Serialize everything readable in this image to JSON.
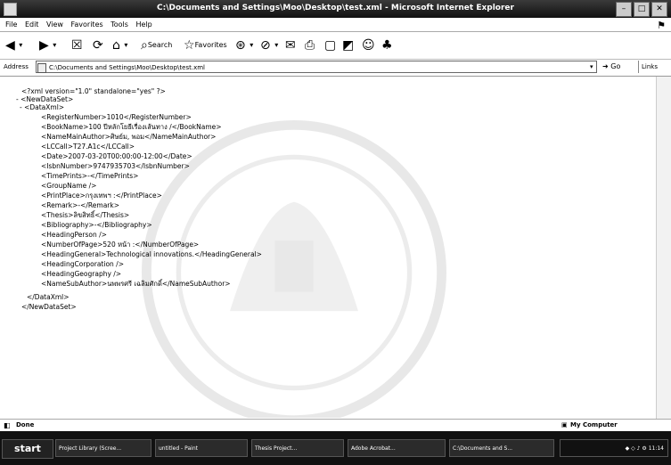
{
  "window": {
    "title": "C:\\Documents and Settings\\Moo\\Desktop\\test.xml - Microsoft Internet Explorer"
  },
  "menu": {
    "items": [
      "File",
      "Edit",
      "View",
      "Favorites",
      "Tools",
      "Help"
    ]
  },
  "toolbar": {
    "search_label": "Search",
    "favorites_label": "Favorites"
  },
  "address": {
    "label": "Address",
    "value": "C:\\Documents and Settings\\Moo\\Desktop\\test.xml",
    "go_label": "Go",
    "links_label": "Links"
  },
  "xml": {
    "lines": [
      "<?xml version=\"1.0\" standalone=\"yes\" ?>",
      "- <NewDataSet>",
      "  - <DataXml>",
      "<RegisterNumber>1010</RegisterNumber>",
      "<BookName>100 ปีหลักโยธีเรื่องเส้นทาง /</BookName>",
      "<NameMainAuthor>ศิษย์ม, พอม</NameMainAuthor>",
      "<LCCall>T27.A1c</LCCall>",
      "<Date>2007-03-20T00:00:00-12:00</Date>",
      "<IsbnNumber>9747935703</IsbnNumber>",
      "<TimePrints>-</TimePrints>",
      "<GroupName />",
      "<PrintPlace>กรุงเทพฯ :</PrintPlace>",
      "<Remark>-</Remark>",
      "<Thesis>ลิขสิทธิ์</Thesis>",
      "<Bibliography>-</Bibliography>",
      "<HeadingPerson />",
      "<NumberOfPage>520 หน้า :</NumberOfPage>",
      "<HeadingGeneral>Technological innovations.</HeadingGeneral>",
      "<HeadingCorporation />",
      "<HeadingGeography />",
      "<NameSubAuthor>นพพรศรี เฉลิมศักดิ์</NameSubAuthor>",
      "  </DataXml>",
      "</NewDataSet>"
    ]
  },
  "status": {
    "text": "Done",
    "zone": "My Computer"
  },
  "taskbar": {
    "start_label": "start",
    "tasks": [
      "Project Library (Scree...",
      "untitled - Paint",
      "Thesis Project...",
      "Adobe Acrobat...",
      "C:\\Documents and S..."
    ],
    "clock": "11:14"
  }
}
